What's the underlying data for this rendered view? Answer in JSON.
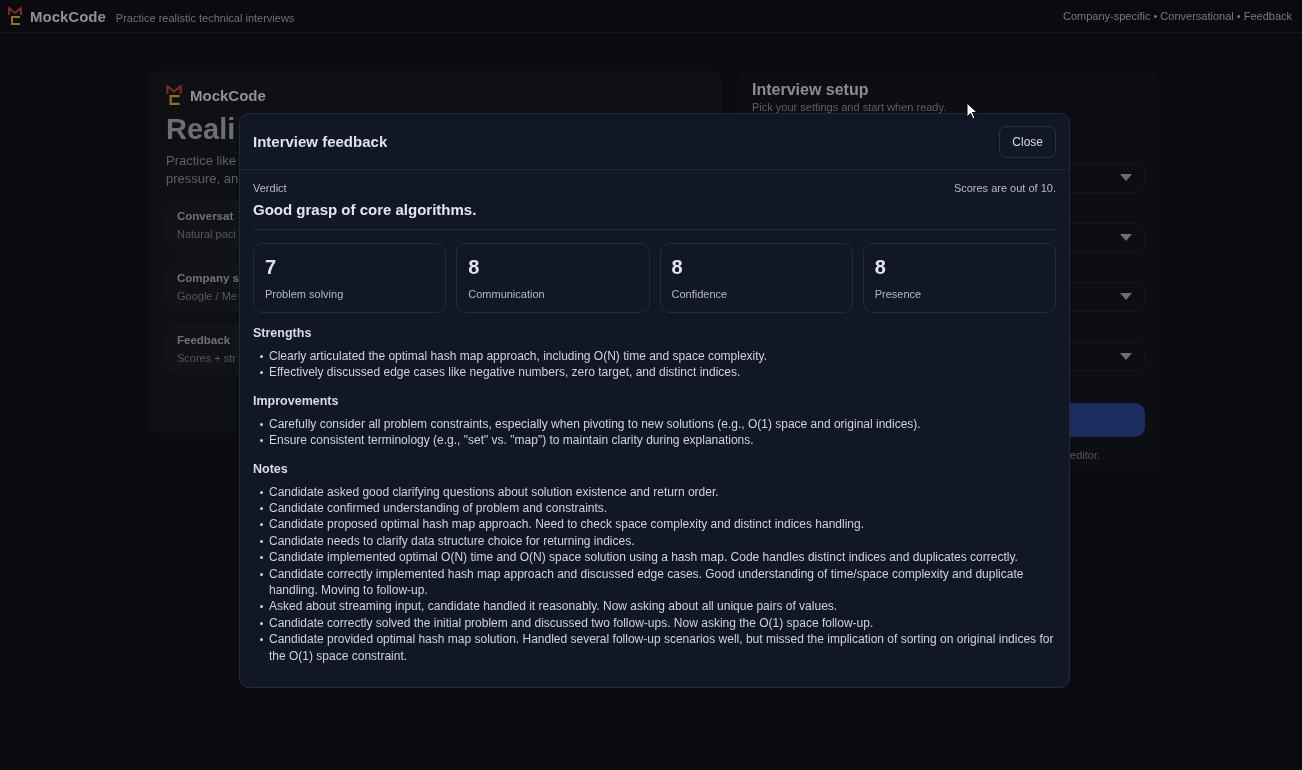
{
  "header": {
    "brand": "MockCode",
    "tagline": "Practice realistic technical interviews",
    "features": "Company-specific • Conversational • Feedback"
  },
  "hero": {
    "brand": "MockCode",
    "heading": "Reali",
    "intro": [
      "Practice like",
      "pressure, an"
    ],
    "features": [
      {
        "title": "Conversat",
        "subtitle": "Natural paci"
      },
      {
        "title": "Company s",
        "subtitle": "Google / Me"
      },
      {
        "title": "Feedback",
        "subtitle": "Scores + str"
      }
    ]
  },
  "setup": {
    "title": "Interview setup",
    "subtitle": "Pick your settings and start when ready.",
    "footnote": "editor."
  },
  "feedback": {
    "title": "Interview feedback",
    "close": "Close",
    "verdict_label": "Verdict",
    "verdict": "Good grasp of core algorithms.",
    "scores_note": "Scores are out of 10.",
    "scores": [
      {
        "value": "7",
        "label": "Problem solving"
      },
      {
        "value": "8",
        "label": "Communication"
      },
      {
        "value": "8",
        "label": "Confidence"
      },
      {
        "value": "8",
        "label": "Presence"
      }
    ],
    "sections": [
      {
        "title": "Strengths",
        "items": [
          "Clearly articulated the optimal hash map approach, including O(N) time and space complexity.",
          "Effectively discussed edge cases like negative numbers, zero target, and distinct indices."
        ]
      },
      {
        "title": "Improvements",
        "items": [
          "Carefully consider all problem constraints, especially when pivoting to new solutions (e.g., O(1) space and original indices).",
          "Ensure consistent terminology (e.g., \"set\" vs. \"map\") to maintain clarity during explanations."
        ]
      },
      {
        "title": "Notes",
        "items": [
          "Candidate asked good clarifying questions about solution existence and return order.",
          "Candidate confirmed understanding of problem and constraints.",
          "Candidate proposed optimal hash map approach. Need to check space complexity and distinct indices handling.",
          "Candidate needs to clarify data structure choice for returning indices.",
          "Candidate implemented optimal O(N) time and O(N) space solution using a hash map. Code handles distinct indices and duplicates correctly.",
          "Candidate correctly implemented hash map approach and discussed edge cases. Good understanding of time/space complexity and duplicate handling. Moving to follow-up.",
          "Asked about streaming input, candidate handled it reasonably. Now asking about all unique pairs of values.",
          "Candidate correctly solved the initial problem and discussed two follow-ups. Now asking the O(1) space follow-up.",
          "Candidate provided optimal hash map solution. Handled several follow-up scenarios well, but missed the implication of sorting on original indices for the O(1) space constraint."
        ]
      }
    ]
  }
}
